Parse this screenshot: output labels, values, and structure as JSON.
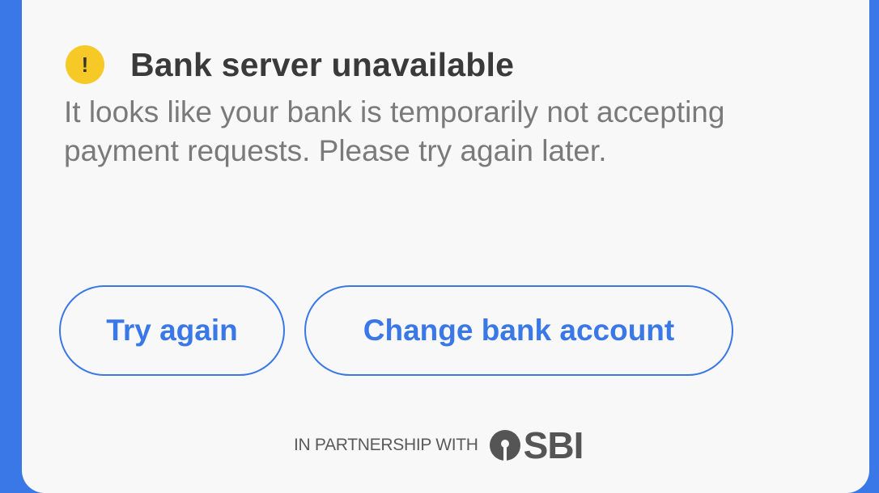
{
  "dialog": {
    "icon": "warning-exclamation-icon",
    "icon_glyph": "!",
    "title": "Bank server unavailable",
    "message": "It looks like your bank is temporarily not accepting payment requests. Please try again later."
  },
  "buttons": {
    "try_again": "Try again",
    "change_bank_account": "Change bank account"
  },
  "footer": {
    "partnership_text": "IN PARTNERSHIP WITH",
    "partner_logo": "sbi-logo-icon",
    "partner_name": "SBI"
  },
  "colors": {
    "accent": "#3b78e7",
    "warning": "#f7c927",
    "title_text": "#3a3a3a",
    "body_text": "#7a7a7a",
    "card_background": "#f8f8f8"
  }
}
